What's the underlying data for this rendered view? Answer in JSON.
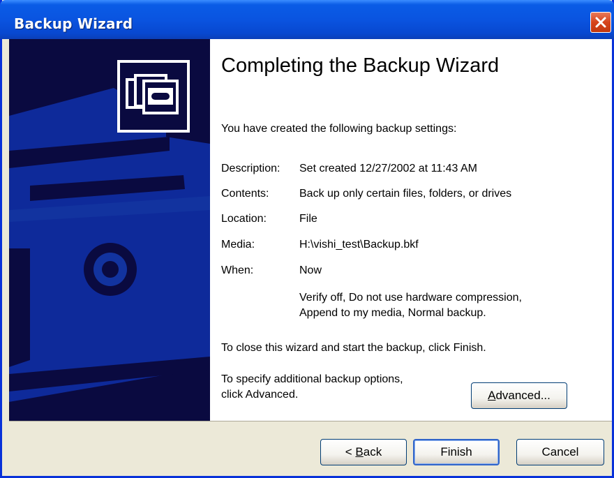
{
  "window": {
    "title": "Backup Wizard"
  },
  "heading": "Completing the Backup Wizard",
  "intro": "You have created the following backup settings:",
  "settings": [
    {
      "label": "Description:",
      "value": "Set created 12/27/2002 at 11:43 AM"
    },
    {
      "label": "Contents:",
      "value": "Back up only certain files, folders, or drives"
    },
    {
      "label": "Location:",
      "value": "File"
    },
    {
      "label": "Media:",
      "value": "H:\\vishi_test\\Backup.bkf"
    },
    {
      "label": "When:",
      "value": "Now"
    }
  ],
  "options_summary": {
    "line1": "Verify off, Do not use hardware compression,",
    "line2": "Append to my media, Normal backup."
  },
  "close_note": "To close this wizard and start the backup, click Finish.",
  "options_note": {
    "line1": "To specify additional backup options,",
    "line2": "click Advanced."
  },
  "buttons": {
    "advanced": {
      "prefix": "",
      "accel": "A",
      "rest": "dvanced..."
    },
    "back": {
      "prefix": "< ",
      "accel": "B",
      "rest": "ack"
    },
    "finish": "Finish",
    "cancel": "Cancel"
  },
  "icons": {
    "close": "close-icon",
    "wizard": "backup-tapes-icon"
  },
  "colors": {
    "titlebar": "#0a54e0",
    "side_panel": "#0a0a40",
    "side_shape": "#0e2a9a",
    "close_button": "#d6431c",
    "dialog_bg": "#ece9d8"
  }
}
